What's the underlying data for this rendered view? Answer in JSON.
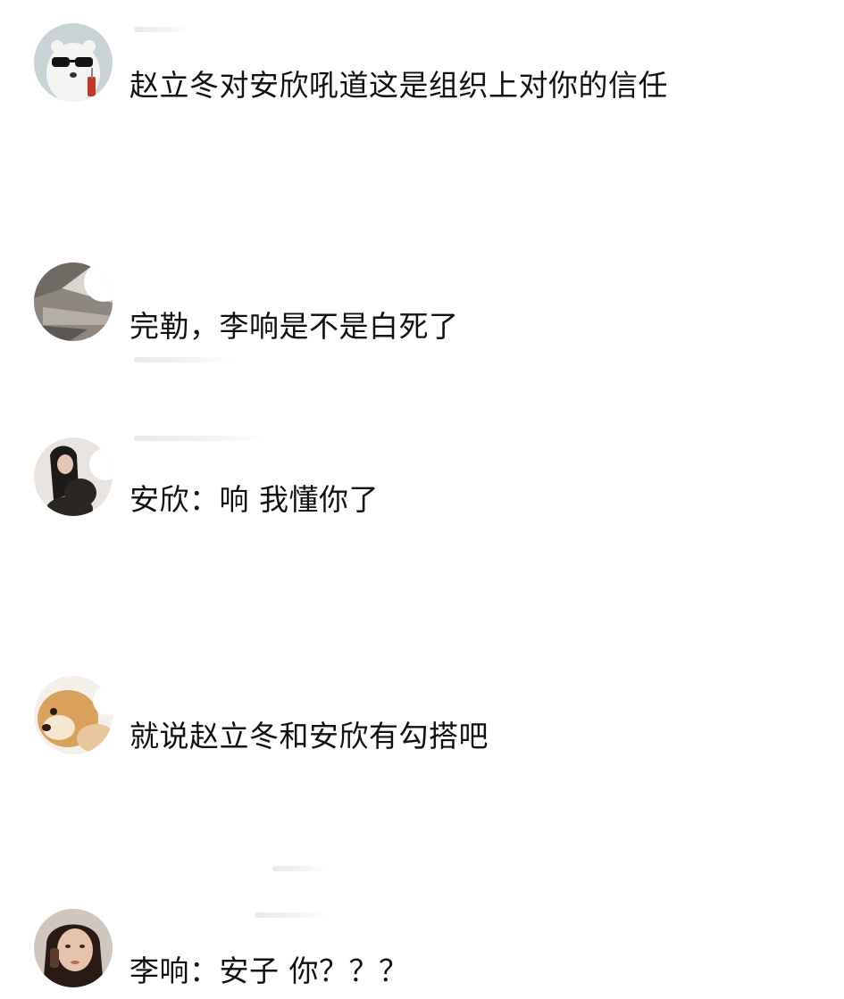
{
  "comments": [
    {
      "text": "赵立冬对安欣吼道这是组织上对你的信任",
      "avatar_icon": "polar-bear-sunglasses-avatar"
    },
    {
      "text": "完勒，李响是不是白死了",
      "avatar_icon": "building-corridor-avatar"
    },
    {
      "text": "安欣：响 我懂你了",
      "avatar_icon": "girl-with-dog-avatar"
    },
    {
      "text": "就说赵立冬和安欣有勾搭吧",
      "avatar_icon": "shiba-dog-avatar"
    },
    {
      "text": "李响：安子 你？？？",
      "avatar_icon": "woman-on-phone-avatar"
    }
  ],
  "colors": {
    "background": "#ffffff",
    "text": "#111111",
    "username_placeholder": "#e6e6e6"
  }
}
